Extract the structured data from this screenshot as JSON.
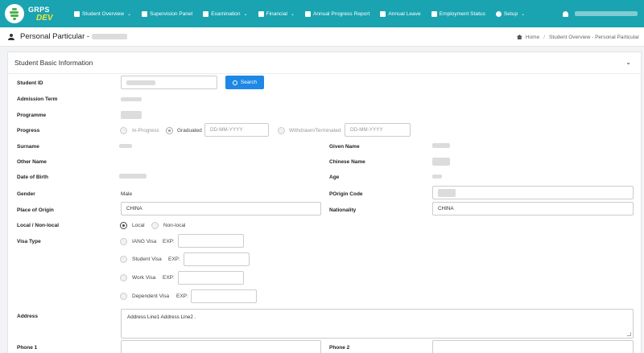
{
  "brand": {
    "name": "GRPS",
    "sub": "DEV"
  },
  "nav": {
    "items": [
      {
        "label": "Student Overview",
        "icon": "user-icon",
        "dropdown": true
      },
      {
        "label": "Supervision Panel",
        "icon": "presentation-icon",
        "dropdown": false
      },
      {
        "label": "Examination",
        "icon": "edit-icon",
        "dropdown": true
      },
      {
        "label": "Financial",
        "icon": "money-icon",
        "dropdown": true
      },
      {
        "label": "Annual Progress Report",
        "icon": "document-icon",
        "dropdown": false
      },
      {
        "label": "Annual Leave",
        "icon": "calendar-icon",
        "dropdown": false
      },
      {
        "label": "Employment Status",
        "icon": "briefcase-icon",
        "dropdown": false
      },
      {
        "label": "Setup",
        "icon": "gear-icon",
        "dropdown": true
      }
    ],
    "user_icon": "user-icon"
  },
  "page": {
    "title": "Personal Particular -",
    "breadcrumb": {
      "home": "Home",
      "sep": "/",
      "current": "Student Overview - Personal Particular"
    }
  },
  "card": {
    "title": "Student Basic Information",
    "collapse_icon": "chevron-down-icon"
  },
  "form": {
    "student_id": {
      "label": "Student ID",
      "search": "Search"
    },
    "admission_term": {
      "label": "Admission Term"
    },
    "programme": {
      "label": "Programme"
    },
    "progress": {
      "label": "Progress",
      "options": [
        "In-Progress",
        "Graduated",
        "Withdrawn/Terminated"
      ],
      "selected": "Graduated",
      "date_placeholder": "DD-MM-YYYY"
    },
    "surname": {
      "label": "Surname"
    },
    "given_name": {
      "label": "Given Name"
    },
    "other_name": {
      "label": "Other Name"
    },
    "chinese_name": {
      "label": "Chinese Name"
    },
    "dob": {
      "label": "Date of Birth"
    },
    "age": {
      "label": "Age"
    },
    "gender": {
      "label": "Gender",
      "value": "Male"
    },
    "porigin_code": {
      "label": "POrigin Code"
    },
    "place_of_origin": {
      "label": "Place of Origin",
      "value": "CHINA"
    },
    "nationality": {
      "label": "Nationality",
      "value": "CHINA"
    },
    "local": {
      "label": "Local / Non-local",
      "options": [
        "Local",
        "Non-local"
      ],
      "selected": "Local"
    },
    "visa": {
      "label": "Visa Type",
      "exp_label": "EXP:",
      "options": [
        "IANG Visa",
        "Student Visa",
        "Work Visa",
        "Dependent Visa"
      ]
    },
    "address": {
      "label": "Address",
      "value": "Address Line1 Address Line2 ."
    },
    "phone1": {
      "label": "Phone 1"
    },
    "phone2": {
      "label": "Phone 2"
    }
  }
}
